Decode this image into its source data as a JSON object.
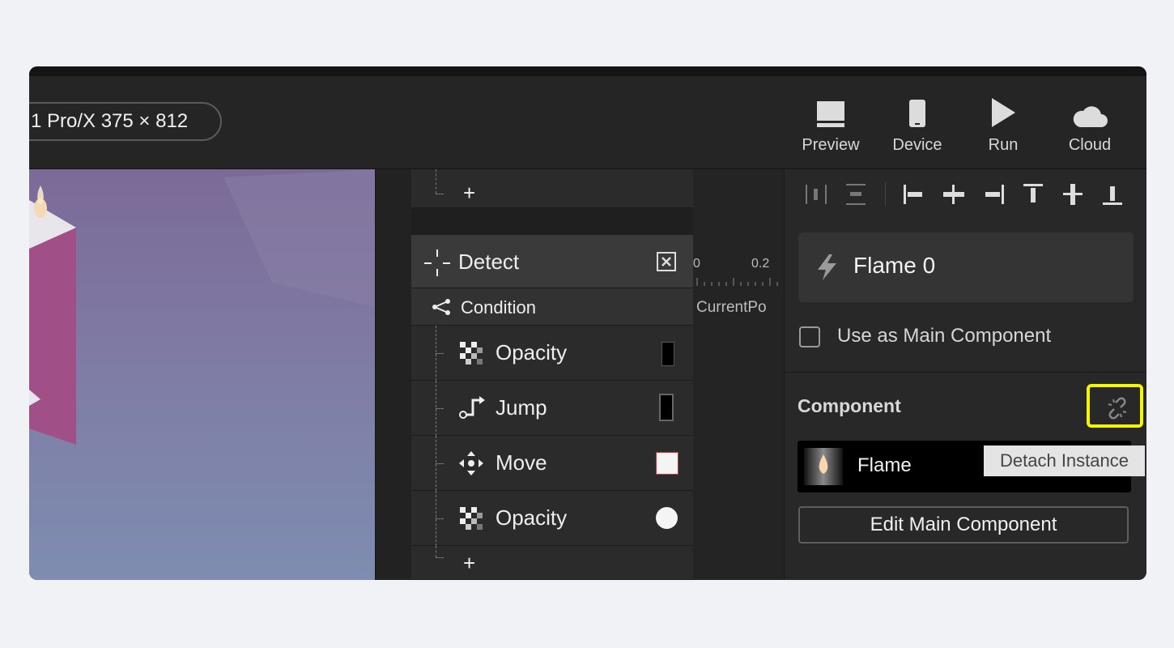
{
  "toolbar": {
    "device_label": "1 Pro/X  375 × 812",
    "buttons": [
      {
        "label": "Preview",
        "icon": "monitor-icon"
      },
      {
        "label": "Device",
        "icon": "phone-icon"
      },
      {
        "label": "Run",
        "icon": "play-icon"
      },
      {
        "label": "Cloud",
        "icon": "cloud-icon"
      }
    ]
  },
  "actions": {
    "top_add": "+",
    "trigger": {
      "label": "Detect",
      "icon": "detect-icon",
      "close_icon": "close-box-icon"
    },
    "condition": {
      "label": "Condition",
      "icon": "branch-icon"
    },
    "items": [
      {
        "label": "Opacity",
        "icon": "checker-icon",
        "swatch": "narrow-black"
      },
      {
        "label": "Jump",
        "icon": "jump-icon",
        "swatch": "black-bar"
      },
      {
        "label": "Move",
        "icon": "move-arrows-icon",
        "swatch": "white-square"
      },
      {
        "label": "Opacity",
        "icon": "checker-icon",
        "swatch": "white-circle"
      }
    ],
    "bottom_add": "+"
  },
  "timeline": {
    "tick_start": "0",
    "tick_next": "0.2",
    "track_label": "CurrentPo"
  },
  "properties": {
    "layer_name": "Flame 0",
    "layer_icon": "lightning-icon",
    "main_component_checkbox_label": "Use as Main Component",
    "main_component_checked": false,
    "component_heading": "Component",
    "component_name": "Flame",
    "edit_button": "Edit Main Component",
    "detach_icon": "unlink-icon",
    "tooltip": "Detach Instance"
  },
  "colors": {
    "highlight": "#f5f500",
    "window_bg": "#252525",
    "page_bg": "#f1f2f6"
  }
}
